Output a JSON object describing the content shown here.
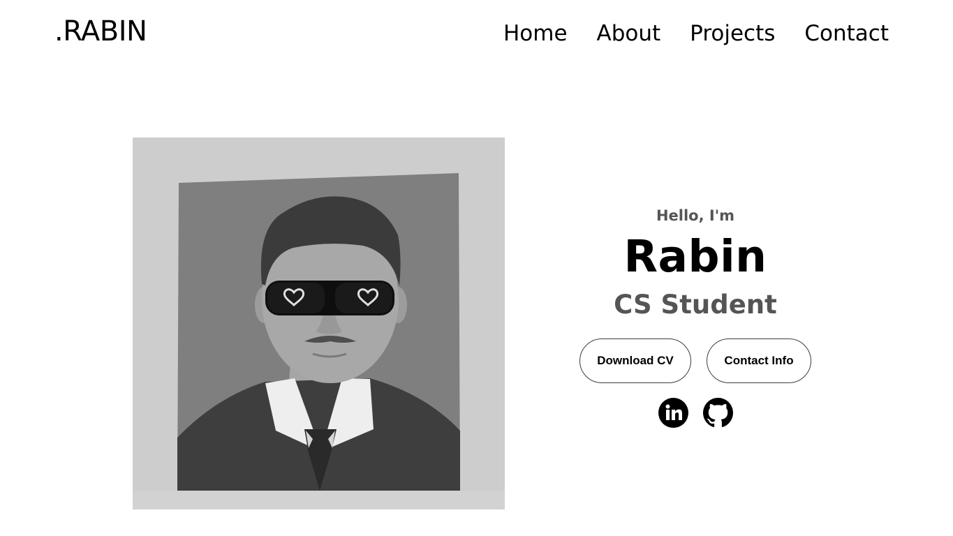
{
  "header": {
    "logo": ".RABIN",
    "nav": [
      "Home",
      "About",
      "Projects",
      "Contact"
    ]
  },
  "profile": {
    "greeting": "Hello, I'm",
    "name": "Rabin",
    "role": "CS Student",
    "buttons": {
      "cv": "Download CV",
      "contact": "Contact Info"
    },
    "socials": [
      {
        "icon": "linkedin-icon"
      },
      {
        "icon": "github-icon"
      }
    ]
  },
  "colors": {
    "text": "#000000",
    "muted": "#555555",
    "button_border": "#3c3c3c"
  }
}
